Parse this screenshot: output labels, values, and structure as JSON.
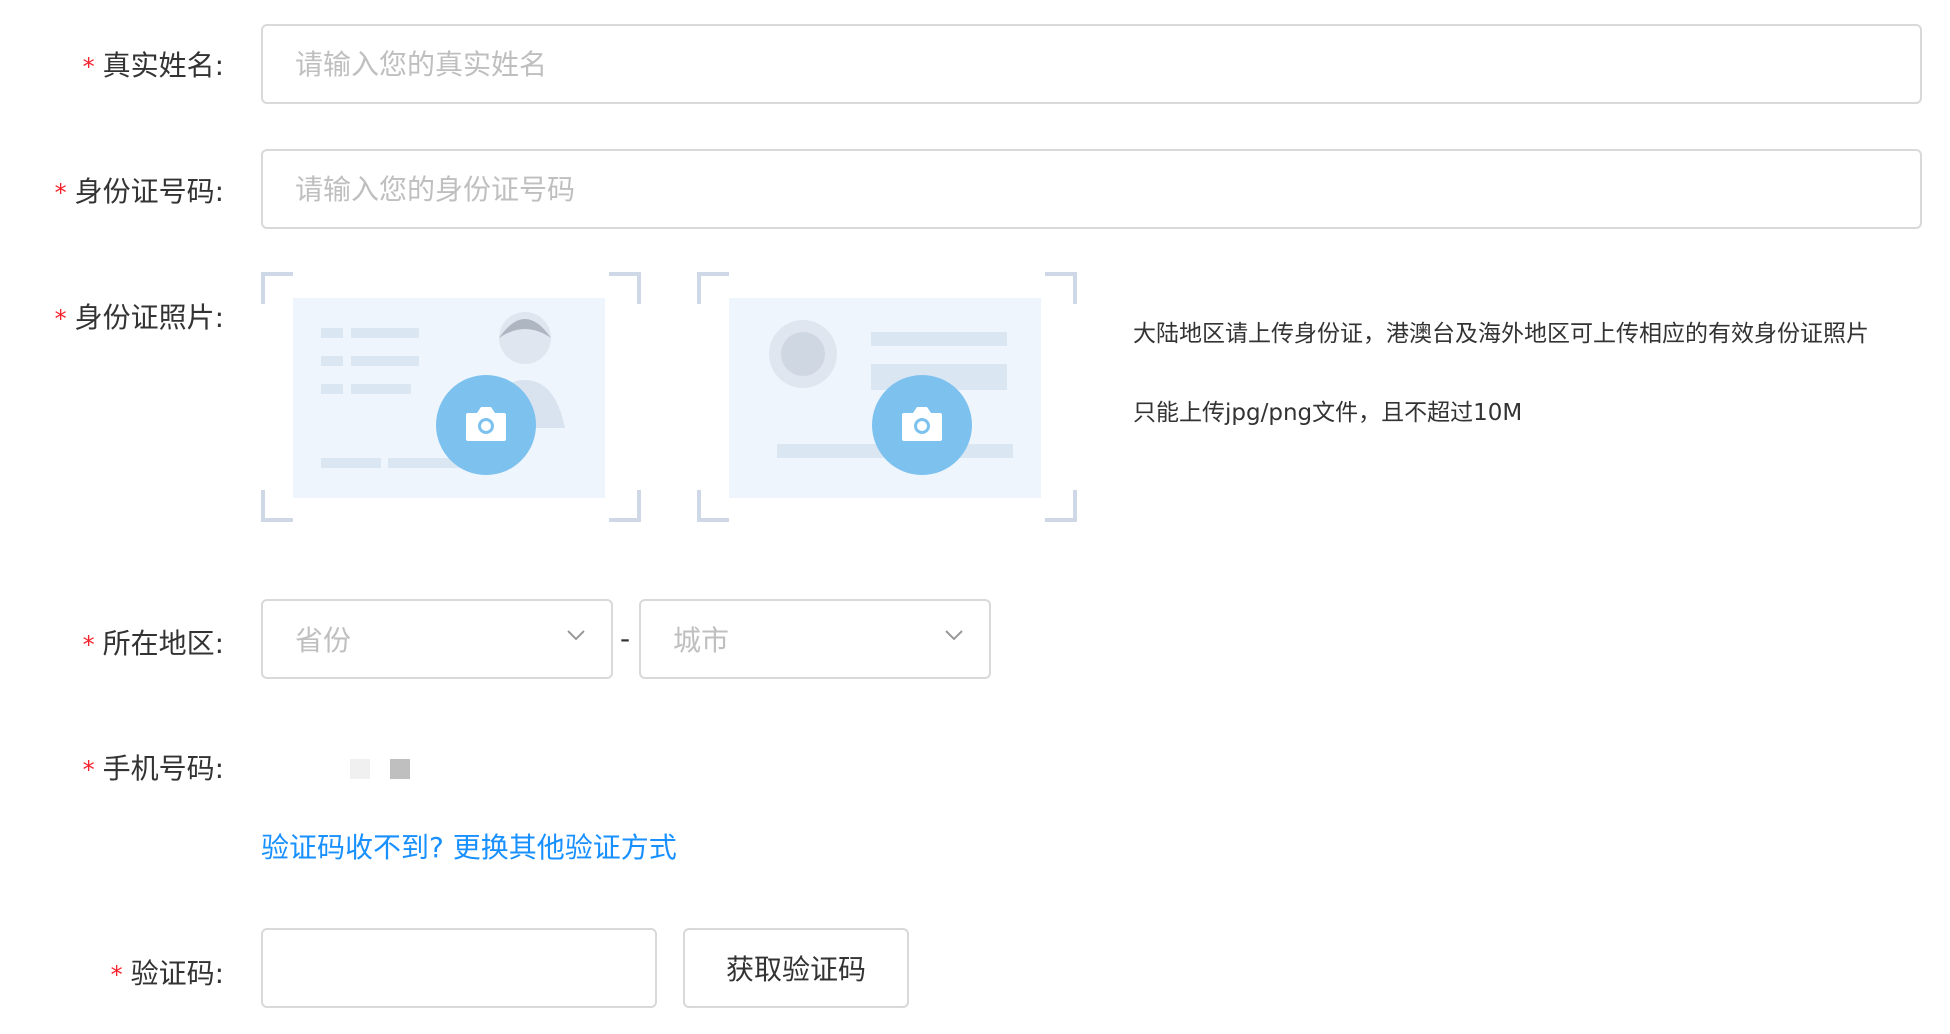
{
  "form": {
    "name": {
      "label": "真实姓名:",
      "placeholder": "请输入您的真实姓名"
    },
    "id_number": {
      "label": "身份证号码:",
      "placeholder": "请输入您的身份证号码"
    },
    "id_photo": {
      "label": "身份证照片:",
      "hint1": "大陆地区请上传身份证，港澳台及海外地区可上传相应的有效身份证照片",
      "hint2": "只能上传jpg/png文件，且不超过10M"
    },
    "region": {
      "label": "所在地区:",
      "province_placeholder": "省份",
      "separator": "-",
      "city_placeholder": "城市"
    },
    "phone": {
      "label": "手机号码:"
    },
    "change_method_link": "验证码收不到? 更换其他验证方式",
    "code": {
      "label": "验证码:",
      "button": "获取验证码"
    },
    "required_mark": "*"
  },
  "colors": {
    "required": "#f5222d",
    "link": "#1890ff",
    "camera": "#7dc1ef",
    "card_bg": "#eef5fd"
  },
  "icons": {
    "camera": "camera-icon",
    "chevron": "chevron-down-icon"
  }
}
